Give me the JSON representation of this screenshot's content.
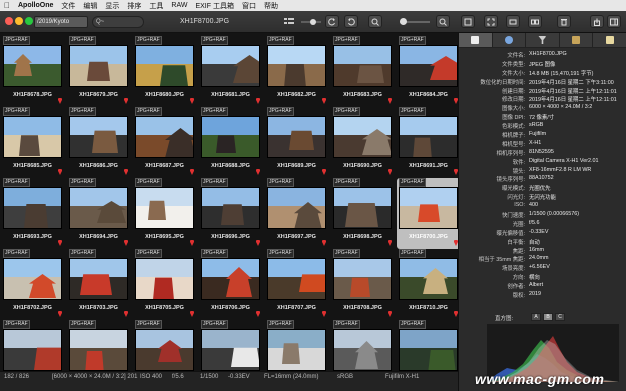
{
  "menubar": {
    "app_name": "ApolloOne",
    "items": [
      "文件",
      "编辑",
      "显示",
      "排序",
      "工具",
      "RAW",
      "EXIF 工具箱",
      "窗口",
      "帮助"
    ]
  },
  "toolbar": {
    "path": "/2019/Kyoto",
    "search_placeholder": "Q~",
    "file_title": "XH1F8700.JPG"
  },
  "badge_label": "JPG+RAF",
  "thumbnails": [
    {
      "name": "XH1F8678.JPG",
      "pin": true
    },
    {
      "name": "XH1F8679.JPG",
      "pin": true
    },
    {
      "name": "XH1F8680.JPG",
      "pin": true
    },
    {
      "name": "XH1F8681.JPG",
      "pin": true
    },
    {
      "name": "XH1F8682.JPG",
      "pin": true
    },
    {
      "name": "XH1F8683.JPG",
      "pin": true
    },
    {
      "name": "XH1F8684.JPG",
      "pin": true
    },
    {
      "name": "XH1F8685.JPG",
      "pin": true
    },
    {
      "name": "XH1F8686.JPG",
      "pin": true
    },
    {
      "name": "XH1F8687.JPG",
      "pin": true
    },
    {
      "name": "XH1F8688.JPG",
      "pin": true
    },
    {
      "name": "XH1F8689.JPG",
      "pin": true
    },
    {
      "name": "XH1F8690.JPG",
      "pin": true
    },
    {
      "name": "XH1F8691.JPG",
      "pin": true
    },
    {
      "name": "XH1F8693.JPG",
      "pin": true
    },
    {
      "name": "XH1F8694.JPG",
      "pin": true
    },
    {
      "name": "XH1F8695.JPG",
      "pin": true
    },
    {
      "name": "XH1F8696.JPG",
      "pin": true
    },
    {
      "name": "XH1F8697.JPG",
      "pin": true
    },
    {
      "name": "XH1F8698.JPG",
      "pin": true
    },
    {
      "name": "XH1F8700.JPG",
      "pin": true,
      "selected": true
    },
    {
      "name": "XH1F8702.JPG",
      "pin": true
    },
    {
      "name": "XH1F8703.JPG",
      "pin": true
    },
    {
      "name": "XH1F8705.JPG",
      "pin": true
    },
    {
      "name": "XH1F8706.JPG",
      "pin": true
    },
    {
      "name": "XH1F8707.JPG",
      "pin": true
    },
    {
      "name": "XH1F8708.JPG",
      "pin": true
    },
    {
      "name": "XH1F8710.JPG",
      "pin": true
    },
    {
      "name": "",
      "pin": false
    },
    {
      "name": "",
      "pin": false
    },
    {
      "name": "",
      "pin": false
    },
    {
      "name": "",
      "pin": false
    },
    {
      "name": "",
      "pin": false
    },
    {
      "name": "",
      "pin": false
    },
    {
      "name": "",
      "pin": false
    }
  ],
  "statusbar": {
    "count": "182 / 826",
    "dimensions": "[6000 × 4000 × 24.0M / 3:2] 201",
    "iso": "ISO 400",
    "aperture": "f/5.6",
    "shutter": "1/1500",
    "ev": "-0.33EV",
    "focal": "FL=16mm (24.0mm)",
    "colorspace": "sRGB",
    "camera": "Fujifilm X-H1"
  },
  "inspector": {
    "tabs": [
      "info-tab",
      "globe-tab",
      "filter-tab",
      "photos-tab",
      "notes-tab"
    ],
    "properties": [
      {
        "k": "文件名:",
        "v": "XH1F8700.JPG"
      },
      {
        "k": "文件类型:",
        "v": "JPEG 图像"
      },
      {
        "k": "文件大小:",
        "v": "14.8 MB (15,470,191 字节)"
      },
      {
        "k": "数位化的日期时间:",
        "v": "2019年4月16日 星期二 下午3:11:00"
      },
      {
        "k": "创建日期:",
        "v": "2019年4月16日 星期二 上午12:11:01"
      },
      {
        "k": "修改日期:",
        "v": "2019年4月16日 星期二 上午12:11:01"
      },
      {
        "k": "图像大小:",
        "v": "6000 × 4000 × 24.0M / 3:2"
      },
      {
        "k": "图像 DPI:",
        "v": "72 像素/寸"
      },
      {
        "k": "色彩模式:",
        "v": "sRGB"
      },
      {
        "k": "相机牌子:",
        "v": "Fujifilm"
      },
      {
        "k": "相机型号:",
        "v": "X-H1"
      },
      {
        "k": "相机序列号:",
        "v": "81N52595"
      },
      {
        "k": "软件:",
        "v": "Digital Camera X-H1 Ver2.01"
      },
      {
        "k": "镜头:",
        "v": "XF8-16mmF2.8 R LM WR"
      },
      {
        "k": "镜头序列号:",
        "v": "88A10752"
      },
      {
        "k": "曝光模式:",
        "v": "光圈优先"
      },
      {
        "k": "闪光灯:",
        "v": "无闪光功能"
      },
      {
        "k": "ISO:",
        "v": "400"
      },
      {
        "k": "快门速度:",
        "v": "1/1500 (0.00066576)"
      },
      {
        "k": "光圈:",
        "v": "f/5.6"
      },
      {
        "k": "曝光偏移值:",
        "v": "-0.33EV"
      },
      {
        "k": "白平衡:",
        "v": "自动"
      },
      {
        "k": "焦距:",
        "v": "16mm"
      },
      {
        "k": "相当于 35mm 焦距:",
        "v": "24.0mm"
      },
      {
        "k": "场景亮度:",
        "v": "+6.56EV"
      },
      {
        "k": "方向:",
        "v": "横向"
      },
      {
        "k": "创作者:",
        "v": "Albert"
      },
      {
        "k": "版权:",
        "v": "2019"
      }
    ],
    "histogram_label": "直方图:",
    "histogram_buttons": [
      "A",
      "B",
      "C"
    ]
  },
  "watermark": "www.mac-gm.com",
  "colors": {
    "selection": "#bfbfbf",
    "pin": "#e03030",
    "histogram_red": "#d63a3a",
    "histogram_green": "#3ab24a",
    "histogram_blue": "#3a6ee0"
  }
}
